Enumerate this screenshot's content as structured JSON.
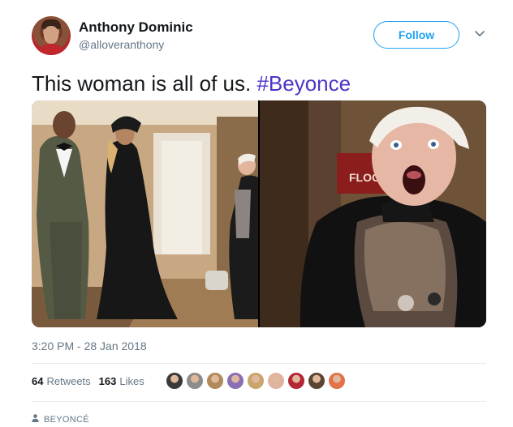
{
  "author": {
    "name": "Anthony Dominic",
    "handle": "@alloveranthony"
  },
  "follow_label": "Follow",
  "tweet": {
    "text": "This woman is all of us.",
    "hashtag": "#Beyonce"
  },
  "media": {
    "left_photo": "photo-beyonce-jayz-hallway",
    "right_photo": "photo-surprised-woman-closeup",
    "sign_text": "FLOO"
  },
  "timestamp": "3:20 PM - 28 Jan 2018",
  "stats": {
    "retweets_count": "64",
    "retweets_label": "Retweets",
    "likes_count": "163",
    "likes_label": "Likes"
  },
  "liker_colors": [
    "#3a3a3a",
    "#8c8c8c",
    "#b08a5a",
    "#8a6fb5",
    "#c9a46b",
    "#e0b3a0",
    "#b32633",
    "#5c4632",
    "#e2724a"
  ],
  "footer_label": "BEYONCÉ",
  "colors": {
    "accent": "#1da1f2",
    "hashtag": "#4a35c8",
    "secondary_text": "#657786"
  }
}
